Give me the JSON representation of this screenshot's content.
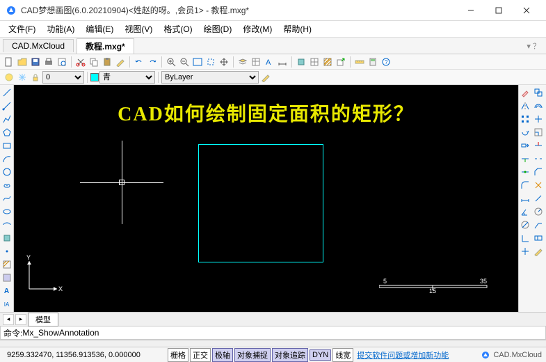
{
  "window": {
    "title": "CAD梦想画图(6.0.20210904)<姓赵的呀。,会员1> - 教程.mxg*"
  },
  "menu": {
    "file": "文件(F)",
    "function": "功能(A)",
    "edit": "编辑(E)",
    "view": "视图(V)",
    "format": "格式(O)",
    "draw": "绘图(D)",
    "modify": "修改(M)",
    "help": "帮助(H)"
  },
  "tabs": {
    "cloud": "CAD.MxCloud",
    "tutorial": "教程.mxg*"
  },
  "props": {
    "layer": "0",
    "color": "青",
    "linetype": "ByLayer"
  },
  "canvas": {
    "headline": "CAD如何绘制固定面积的矩形？",
    "ucs_y": "Y",
    "ucs_x": "X",
    "scale_left": "5",
    "scale_mid": "15",
    "scale_right": "35"
  },
  "modeltab": {
    "label": "模型"
  },
  "cmd": {
    "prefix": "命令: ",
    "text": "Mx_ShowAnnotation"
  },
  "status": {
    "coords": "9259.332470, 11356.913536, 0.000000",
    "grid": "栅格",
    "ortho": "正交",
    "polar": "极轴",
    "osnap": "对象捕捉",
    "otrack": "对象追踪",
    "dyn": "DYN",
    "lwt": "线宽",
    "link": "提交软件问题或增加新功能",
    "brand": "CAD.MxCloud"
  }
}
